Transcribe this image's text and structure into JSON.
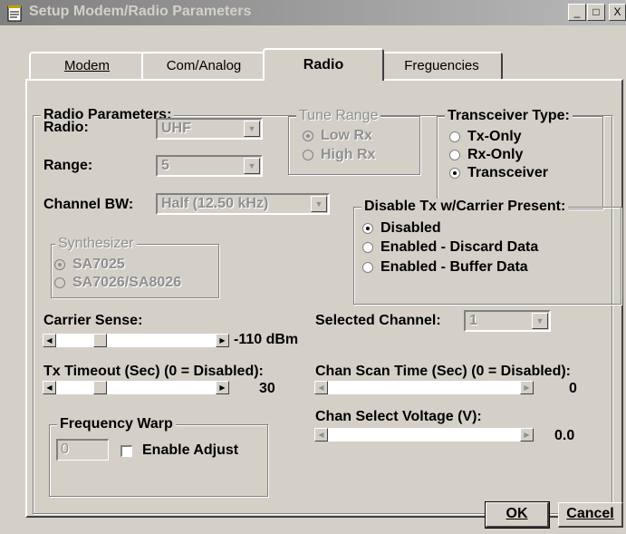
{
  "window": {
    "title": "Setup Modem/Radio Parameters",
    "minimize": "_",
    "maximize": "□",
    "close": "X"
  },
  "tabs": [
    "Modem",
    "Com/Analog",
    "Radio",
    "Freguencies"
  ],
  "active_tab": "Radio",
  "radio_params": {
    "group_label": "Radio Parameters:",
    "radio_label": "Radio:",
    "radio_value": "UHF",
    "range_label": "Range:",
    "range_value": "5",
    "channel_bw_label": "Channel BW:",
    "channel_bw_value": "Half (12.50 kHz)"
  },
  "tune_range": {
    "label": "Tune Range",
    "options": [
      "Low Rx",
      "High Rx"
    ],
    "selected": "Low Rx"
  },
  "transceiver_type": {
    "label": "Transceiver Type:",
    "options": [
      "Tx-Only",
      "Rx-Only",
      "Transceiver"
    ],
    "selected": "Transceiver"
  },
  "disable_tx": {
    "label": "Disable Tx w/Carrier Present:",
    "options": [
      "Disabled",
      "Enabled - Discard Data",
      "Enabled - Buffer Data"
    ],
    "selected": "Disabled"
  },
  "synthesizer": {
    "label": "Synthesizer",
    "options": [
      "SA7025",
      "SA7026/SA8026"
    ],
    "selected": "SA7025"
  },
  "carrier_sense": {
    "label": "Carrier Sense:",
    "value": "-110 dBm",
    "position": 0.12
  },
  "tx_timeout": {
    "label": "Tx Timeout (Sec) (0 = Disabled):",
    "value": "30",
    "position": 0.12
  },
  "selected_channel": {
    "label": "Selected Channel:",
    "value": "1"
  },
  "chan_scan_time": {
    "label": "Chan Scan Time (Sec) (0 = Disabled):",
    "value": "0"
  },
  "chan_select_voltage": {
    "label": "Chan Select Voltage (V):",
    "value": "0.0"
  },
  "frequency_warp": {
    "label": "Frequency Warp",
    "value": "0",
    "enable_adjust_label": "Enable Adjust"
  },
  "buttons": {
    "ok": "OK",
    "cancel": "Cancel"
  }
}
